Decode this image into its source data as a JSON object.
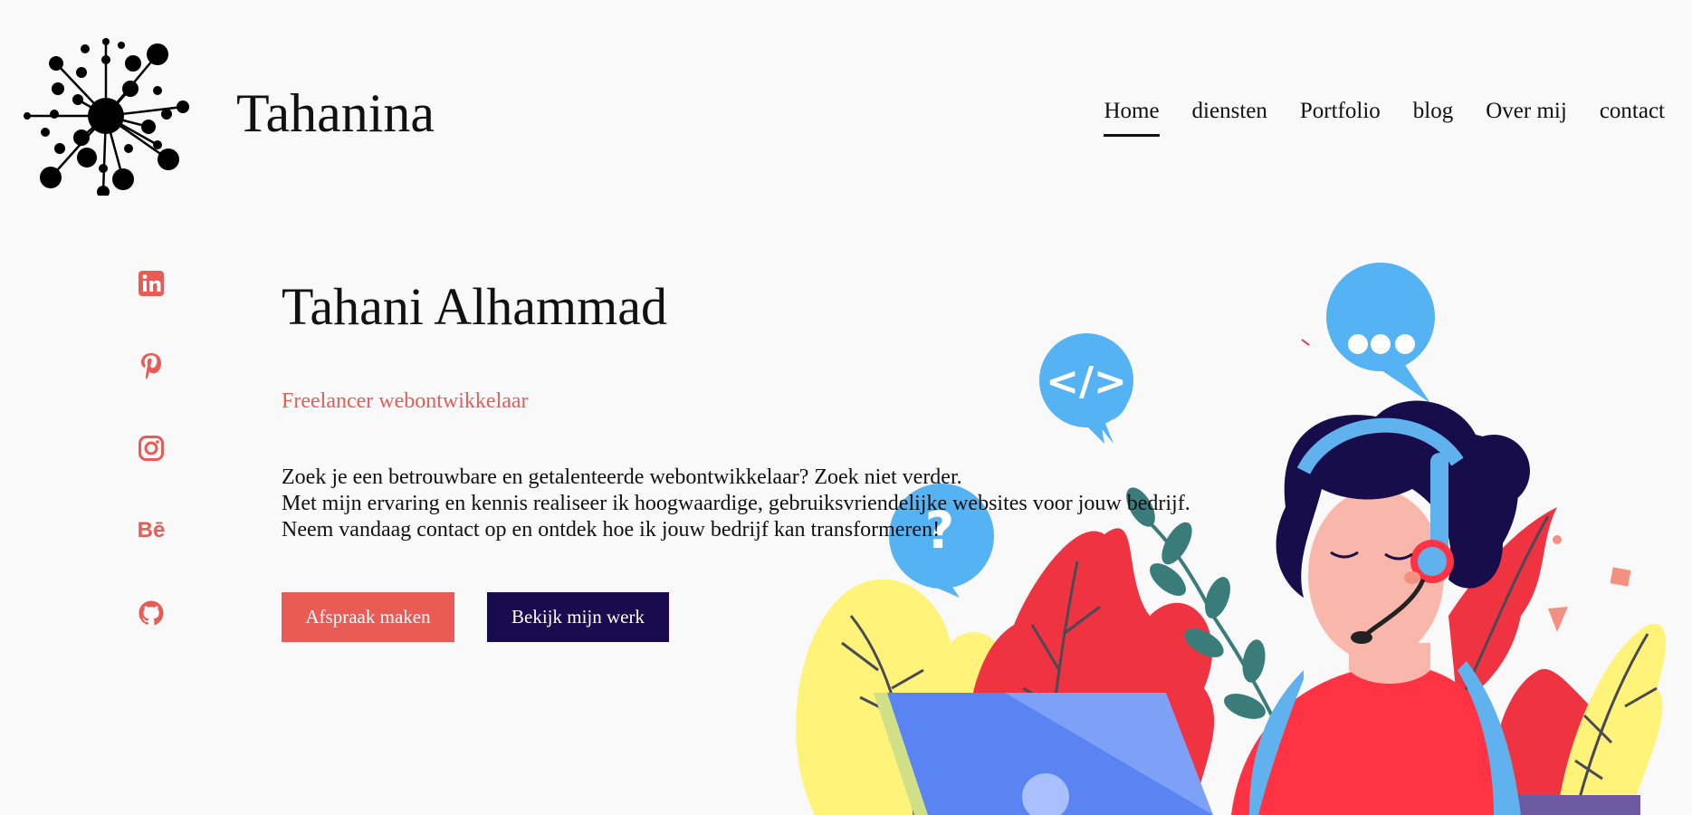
{
  "header": {
    "brand": "Tahanina",
    "logo_icon": "network-dots-logo",
    "nav": [
      {
        "label": "Home",
        "active": true
      },
      {
        "label": "diensten",
        "active": false
      },
      {
        "label": "Portfolio",
        "active": false
      },
      {
        "label": "blog",
        "active": false
      },
      {
        "label": "Over mij",
        "active": false
      },
      {
        "label": "contact",
        "active": false
      }
    ]
  },
  "social": [
    {
      "icon": "linkedin-icon"
    },
    {
      "icon": "pinterest-icon"
    },
    {
      "icon": "instagram-icon"
    },
    {
      "icon": "behance-icon",
      "glyph": "Bē"
    },
    {
      "icon": "github-icon"
    }
  ],
  "hero": {
    "name": "Tahani Alhammad",
    "subtitle": "Freelancer webontwikkelaar",
    "intro": [
      "Zoek je een betrouwbare en getalenteerde webontwikkelaar? Zoek niet verder.",
      "Met mijn ervaring en kennis realiseer ik hoogwaardige, gebruiksvriendelijke websites voor jouw bedrijf.",
      "Neem vandaag contact op en ontdek hoe ik jouw bedrijf kan transformeren!"
    ],
    "primary_button": "Afspraak maken",
    "secondary_button": "Bekijk mijn werk"
  },
  "colors": {
    "accent": "#e85c55",
    "dark_button": "#1a0b4e",
    "background": "#f9f9f9"
  }
}
